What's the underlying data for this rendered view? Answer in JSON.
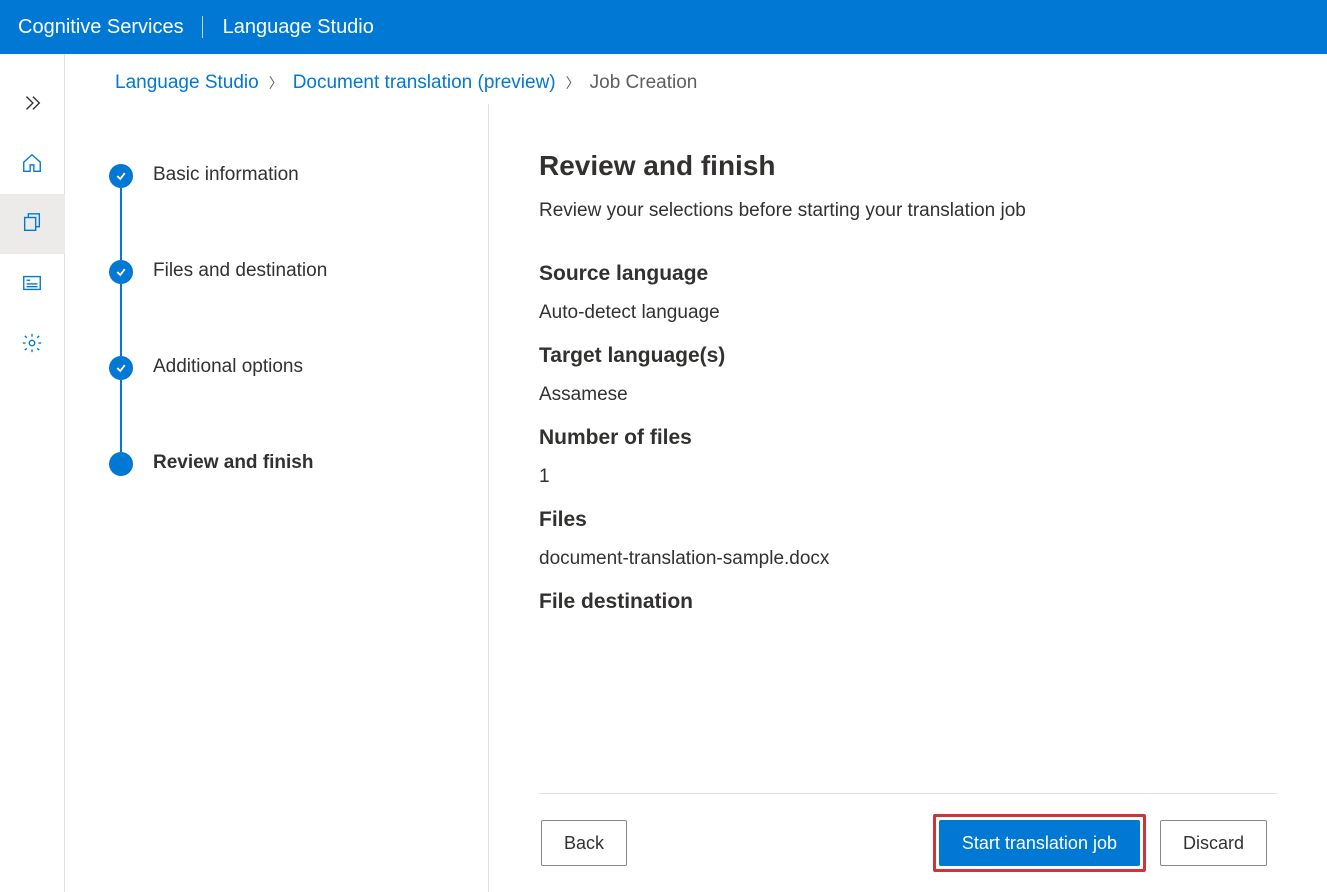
{
  "topbar": {
    "service": "Cognitive Services",
    "studio": "Language Studio"
  },
  "breadcrumb": {
    "item1": "Language Studio",
    "item2": "Document translation (preview)",
    "item3": "Job Creation"
  },
  "stepper": {
    "s1": "Basic information",
    "s2": "Files and destination",
    "s3": "Additional options",
    "s4": "Review and finish"
  },
  "review": {
    "title": "Review and finish",
    "subtitle": "Review your selections before starting your translation job",
    "source_lang_label": "Source language",
    "source_lang_value": "Auto-detect language",
    "target_lang_label": "Target language(s)",
    "target_lang_value": "Assamese",
    "num_files_label": "Number of files",
    "num_files_value": "1",
    "files_label": "Files",
    "files_value": "document-translation-sample.docx",
    "file_dest_label": "File destination"
  },
  "buttons": {
    "back": "Back",
    "start": "Start translation job",
    "discard": "Discard"
  }
}
